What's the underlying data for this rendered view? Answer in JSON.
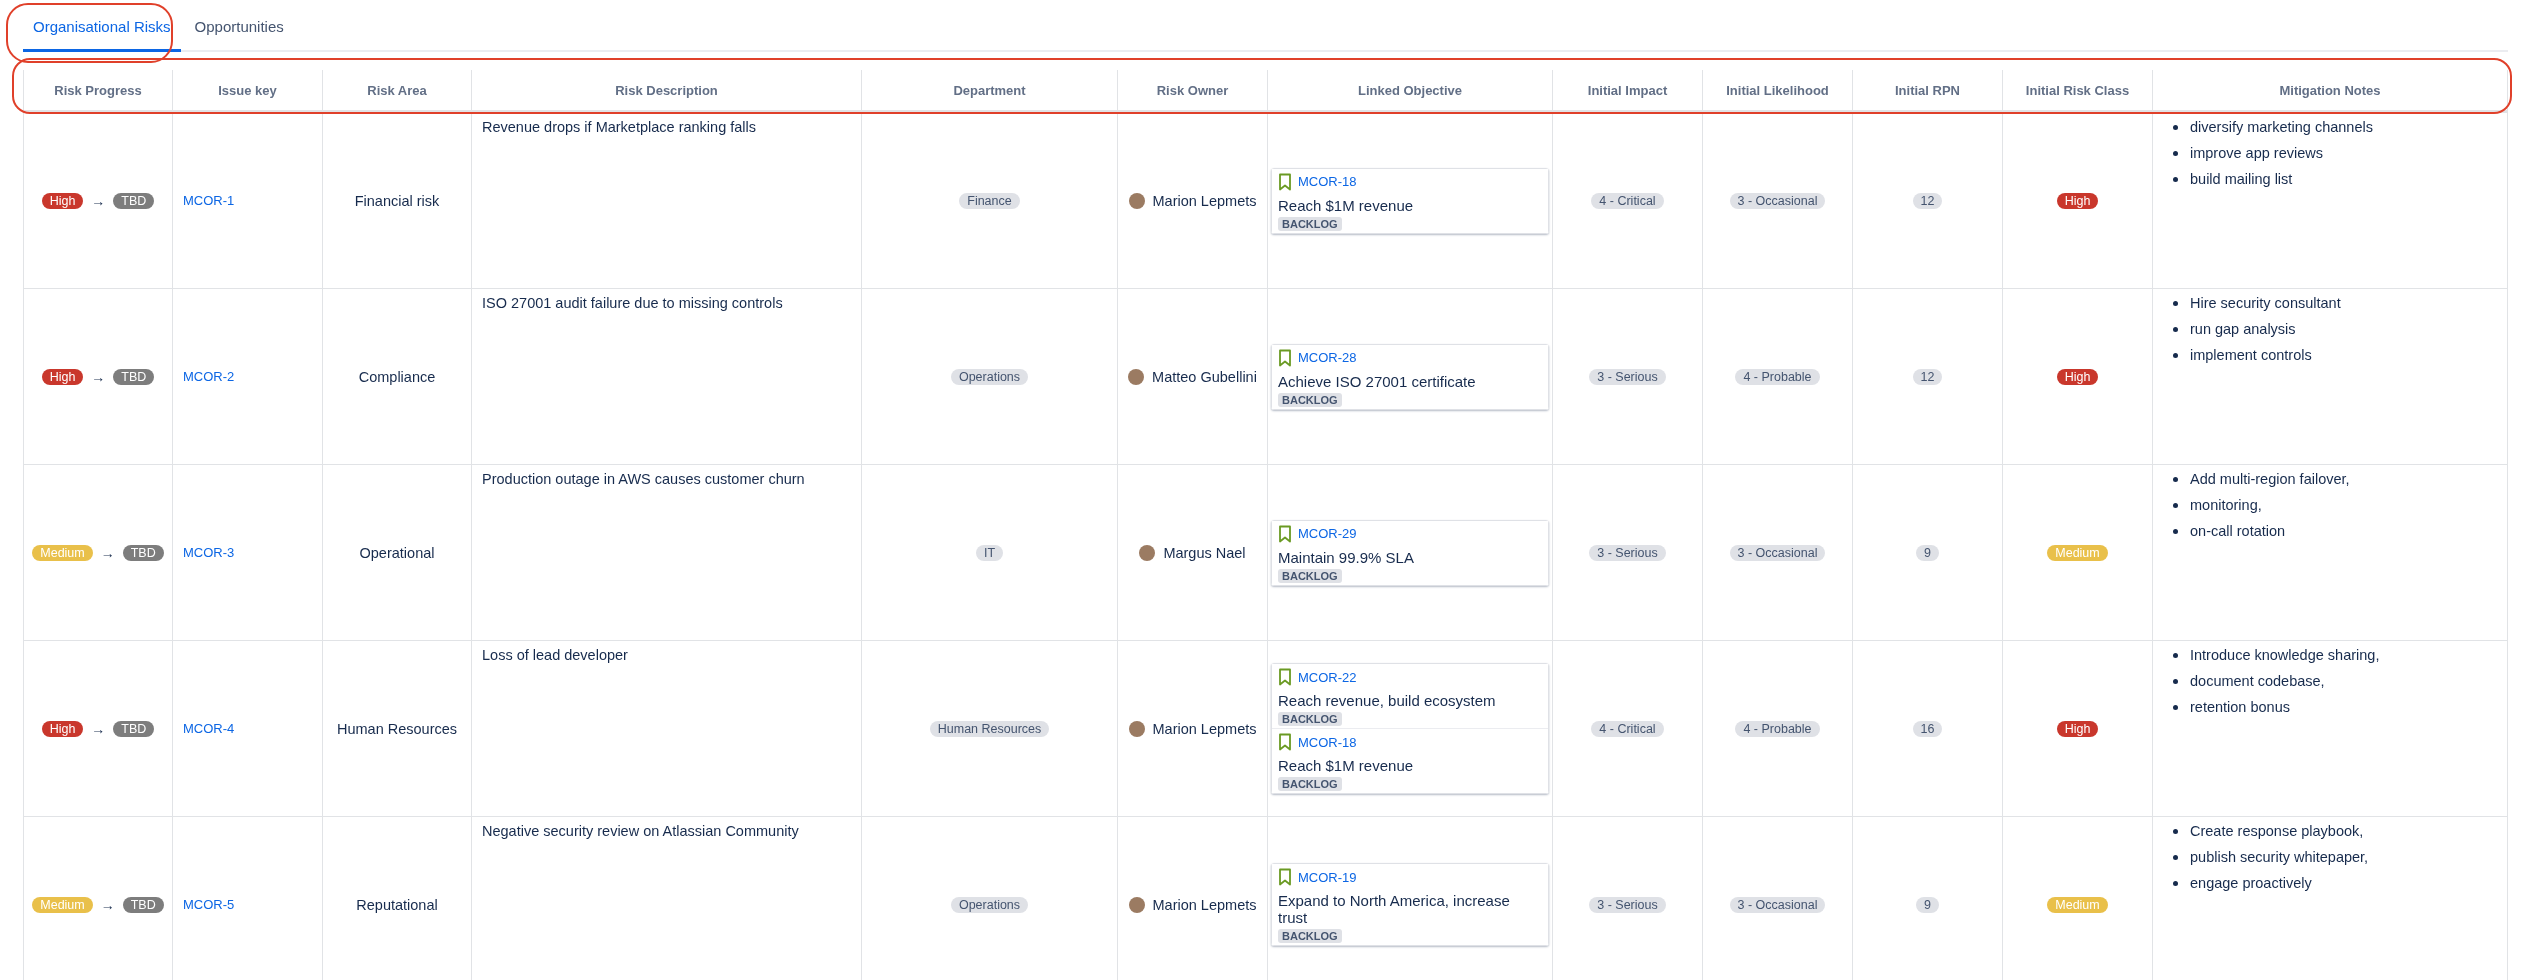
{
  "tabs": [
    {
      "label": "Organisational Risks",
      "selected": true
    },
    {
      "label": "Opportunities",
      "selected": false
    }
  ],
  "table": {
    "columns": [
      "Risk Progress",
      "Issue key",
      "Risk Area",
      "Risk Description",
      "Department",
      "Risk Owner",
      "Linked Objective",
      "Initial Impact",
      "Initial Likelihood",
      "Initial RPN",
      "Initial Risk Class",
      "Mitigation Notes"
    ],
    "rows": [
      {
        "risk_progress": {
          "from": {
            "label": "High",
            "color": "#c9372c"
          },
          "arrow": "→",
          "to": {
            "label": "TBD",
            "color": "#7d7d7d"
          }
        },
        "issue_key": "MCOR-1",
        "risk_area": "Financial risk",
        "risk_description": "Revenue drops if Marketplace ranking falls",
        "department": "Finance",
        "risk_owner": "Marion Lepmets",
        "linked_objectives": [
          {
            "key": "MCOR-18",
            "title": "Reach $1M revenue",
            "status": "BACKLOG"
          }
        ],
        "initial_impact": "4 - Critical",
        "initial_likelihood": "3 - Occasional",
        "initial_rpn": "12",
        "initial_risk_class": {
          "label": "High",
          "color": "#c9372c"
        },
        "mitigation_notes": [
          "diversify marketing channels",
          "improve app reviews",
          "build mailing list"
        ]
      },
      {
        "risk_progress": {
          "from": {
            "label": "High",
            "color": "#c9372c"
          },
          "arrow": "→",
          "to": {
            "label": "TBD",
            "color": "#7d7d7d"
          }
        },
        "issue_key": "MCOR-2",
        "risk_area": "Compliance",
        "risk_description": "ISO 27001 audit failure due to missing controls",
        "department": "Operations",
        "risk_owner": "Matteo Gubellini",
        "linked_objectives": [
          {
            "key": "MCOR-28",
            "title": "Achieve ISO 27001 certificate",
            "status": "BACKLOG"
          }
        ],
        "initial_impact": "3 - Serious",
        "initial_likelihood": "4 - Probable",
        "initial_rpn": "12",
        "initial_risk_class": {
          "label": "High",
          "color": "#c9372c"
        },
        "mitigation_notes": [
          "Hire security consultant",
          "run gap analysis",
          "implement controls"
        ]
      },
      {
        "risk_progress": {
          "from": {
            "label": "Medium",
            "color": "#e9c04a"
          },
          "arrow": "→",
          "to": {
            "label": "TBD",
            "color": "#7d7d7d"
          }
        },
        "issue_key": "MCOR-3",
        "risk_area": "Operational",
        "risk_description": "Production outage in AWS causes customer churn",
        "department": "IT",
        "risk_owner": "Margus Nael",
        "linked_objectives": [
          {
            "key": "MCOR-29",
            "title": "Maintain 99.9% SLA",
            "status": "BACKLOG"
          }
        ],
        "initial_impact": "3 - Serious",
        "initial_likelihood": "3 - Occasional",
        "initial_rpn": "9",
        "initial_risk_class": {
          "label": "Medium",
          "color": "#e9c04a"
        },
        "mitigation_notes": [
          "Add multi-region failover,",
          "monitoring,",
          "on-call rotation"
        ]
      },
      {
        "risk_progress": {
          "from": {
            "label": "High",
            "color": "#c9372c"
          },
          "arrow": "→",
          "to": {
            "label": "TBD",
            "color": "#7d7d7d"
          }
        },
        "issue_key": "MCOR-4",
        "risk_area": "Human Resources",
        "risk_description": "Loss of lead developer",
        "department": "Human Resources",
        "risk_owner": "Marion Lepmets",
        "linked_objectives": [
          {
            "key": "MCOR-22",
            "title": "Reach revenue, build ecosystem",
            "status": "BACKLOG"
          },
          {
            "key": "MCOR-18",
            "title": "Reach $1M revenue",
            "status": "BACKLOG"
          }
        ],
        "initial_impact": "4 - Critical",
        "initial_likelihood": "4 - Probable",
        "initial_rpn": "16",
        "initial_risk_class": {
          "label": "High",
          "color": "#c9372c"
        },
        "mitigation_notes": [
          "Introduce knowledge sharing,",
          "document codebase,",
          "retention bonus"
        ]
      },
      {
        "risk_progress": {
          "from": {
            "label": "Medium",
            "color": "#e9c04a"
          },
          "arrow": "→",
          "to": {
            "label": "TBD",
            "color": "#7d7d7d"
          }
        },
        "issue_key": "MCOR-5",
        "risk_area": "Reputational",
        "risk_description": "Negative security review on Atlassian Community",
        "department": "Operations",
        "risk_owner": "Marion Lepmets",
        "linked_objectives": [
          {
            "key": "MCOR-19",
            "title": "Expand to North America, increase trust",
            "status": "BACKLOG"
          }
        ],
        "initial_impact": "3 - Serious",
        "initial_likelihood": "3 - Occasional",
        "initial_rpn": "9",
        "initial_risk_class": {
          "label": "Medium",
          "color": "#e9c04a"
        },
        "mitigation_notes": [
          "Create response playbook,",
          "publish security whitepaper,",
          "engage proactively"
        ]
      }
    ]
  }
}
